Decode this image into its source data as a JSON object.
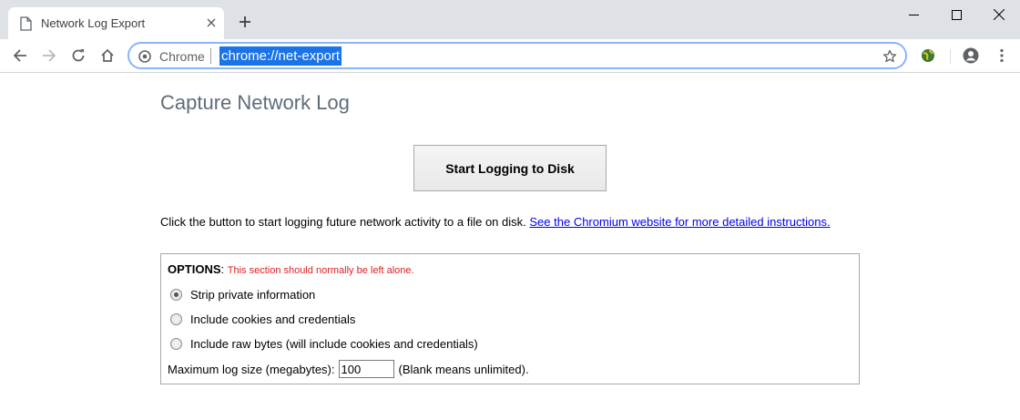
{
  "tab": {
    "title": "Network Log Export"
  },
  "omnibox": {
    "chip_label": "Chrome",
    "url": "chrome://net-export"
  },
  "page": {
    "title": "Capture Network Log",
    "start_button_label": "Start Logging to Disk",
    "description": "Click the button to start logging future network activity to a file on disk.",
    "description_link": "See the Chromium website for more detailed instructions."
  },
  "options": {
    "heading": "OPTIONS",
    "warning": "This section should normally be left alone.",
    "radios": [
      {
        "label": "Strip private information",
        "checked": true
      },
      {
        "label": "Include cookies and credentials",
        "checked": false
      },
      {
        "label": "Include raw bytes (will include cookies and credentials)",
        "checked": false
      }
    ],
    "max_size_label": "Maximum log size (megabytes):",
    "max_size_value": "100",
    "max_size_hint": "(Blank means unlimited)."
  }
}
